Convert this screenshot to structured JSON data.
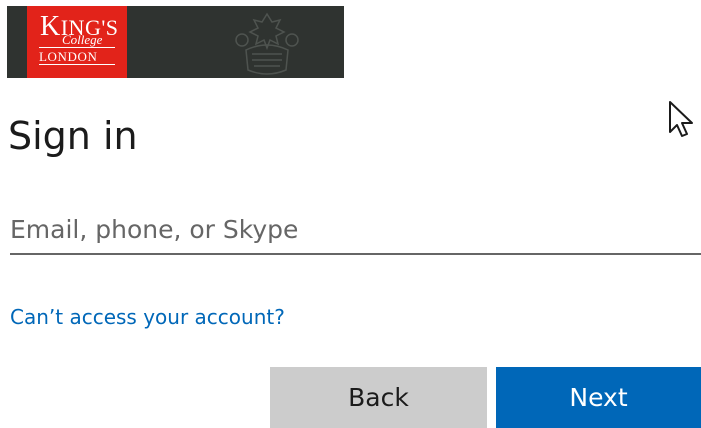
{
  "banner": {
    "logo": {
      "line1_initial": "K",
      "line1_rest": "ING'S",
      "line2": "College",
      "line3": "LONDON"
    },
    "colors": {
      "logo_red": "#e2231a",
      "banner_bg": "#2f3330"
    }
  },
  "heading": {
    "title": "Sign in"
  },
  "form": {
    "email": {
      "value": "",
      "placeholder": "Email, phone, or Skype"
    },
    "cant_access_link": "Can’t access your account?",
    "back_label": "Back",
    "next_label": "Next"
  },
  "colors": {
    "accent": "#0067b8",
    "back_button_bg": "#cccccc",
    "text": "#1b1b1b"
  },
  "icons": {
    "crest": "crest-icon",
    "cursor": "mouse-pointer-icon"
  }
}
